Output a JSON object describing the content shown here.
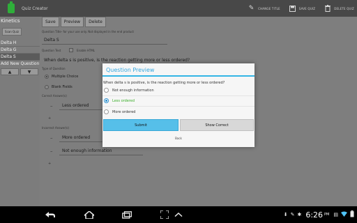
{
  "actionbar": {
    "title": "Quiz Creator",
    "actions": [
      {
        "label": "CHANGE TITLE",
        "icon": "pencil-icon"
      },
      {
        "label": "SAVE QUIZ",
        "icon": "save-icon"
      },
      {
        "label": "DELETE QUIZ",
        "icon": "trash-icon"
      }
    ]
  },
  "sidebar": {
    "header": "Kinetics",
    "scan_button": "Scan Quiz",
    "items": [
      "Delta H",
      "Delta G",
      "Delta S"
    ],
    "selected_index": 2,
    "add_label": "Add New Question",
    "up_arrow": "▲",
    "down_arrow": "▼"
  },
  "toolbar": {
    "save_label": "Save",
    "preview_label": "Preview",
    "delete_label": "Delete"
  },
  "editor": {
    "title_hint": "Question Title- for your use only. Not displayed in the end product",
    "title_value": "Delta S",
    "text_label": "Question Text",
    "html_label": "Enable HTML",
    "question_value": "When delta s is positive, is the reaction getting more or less ordered?",
    "type_label": "Type of Question",
    "type_multiple": "Multiple Choice",
    "type_blank": "Blank Fields",
    "correct_label": "Correct Answer(s)",
    "correct_value": "Less ordered",
    "incorrect_label": "Incorrect Answer(s)",
    "incorrect_values": [
      "More ordered",
      "Not enough information"
    ],
    "dash": "–",
    "plus": "+"
  },
  "dialog": {
    "title": "Question Preview",
    "question": "When delta s is positive, is the reaction getting more or less ordered?",
    "options": [
      {
        "label": "Not enough information",
        "selected": false,
        "correct": false
      },
      {
        "label": "Less ordered",
        "selected": true,
        "correct": true
      },
      {
        "label": "More ordered",
        "selected": false,
        "correct": false
      }
    ],
    "submit_label": "Submit",
    "show_correct_label": "Show Correct",
    "back_label": "Back"
  },
  "sysbar": {
    "back_icon": "back-icon",
    "home_icon": "home-icon",
    "recents_icon": "recents-icon",
    "screenshot_icon": "screenshot-icon",
    "menu_up_icon": "menu-up-icon",
    "time": "6:26",
    "ampm": "PM"
  },
  "colors": {
    "accent": "#33b5e5",
    "submit_button": "#56bfe9",
    "correct_text": "#3bae2a",
    "app_icon": "#2fae3a"
  }
}
